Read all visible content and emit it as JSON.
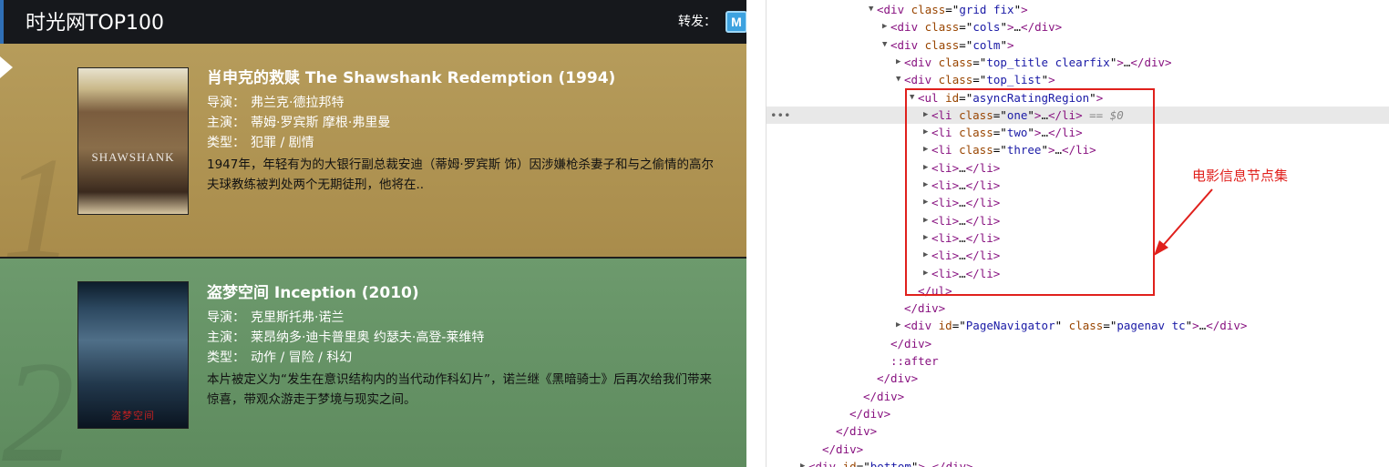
{
  "left_panel": {
    "header_title": "时光网TOP100",
    "share_label": "转发：",
    "share_icon_letter": "M",
    "movies": [
      {
        "rank": "1",
        "title": "肖申克的救赎 The Shawshank Redemption (1994)",
        "director_label": "导演：",
        "director": "弗兰克·德拉邦特",
        "cast_label": "主演：",
        "cast": "蒂姆·罗宾斯  摩根·弗里曼",
        "genre_label": "类型：",
        "genre": "犯罪 / 剧情",
        "description": "1947年，年轻有为的大银行副总裁安迪（蒂姆·罗宾斯 饰）因涉嫌枪杀妻子和与之偷情的高尔夫球教练被判处两个无期徒刑，他将在..",
        "poster_text": "SHAWSHANK"
      },
      {
        "rank": "2",
        "title": "盗梦空间 Inception (2010)",
        "director_label": "导演：",
        "director": "克里斯托弗·诺兰",
        "cast_label": "主演：",
        "cast": "莱昂纳多·迪卡普里奥  约瑟夫·高登-莱维特",
        "genre_label": "类型：",
        "genre": "动作 / 冒险 / 科幻",
        "description": "本片被定义为“发生在意识结构内的当代动作科幻片”，诺兰继《黑暗骑士》后再次给我们带来惊喜，带观众游走于梦境与现实之间。",
        "poster_text": "盗梦空间"
      }
    ]
  },
  "devtools": {
    "lines": [
      {
        "indent": 112,
        "tri": "▼",
        "html": "<span class='tag'>&lt;div</span> <span class='attr'>class</span>=\"<span class='val'>grid fix</span>\"<span class='tag'>&gt;</span>"
      },
      {
        "indent": 127,
        "tri": "▶",
        "html": "<span class='tag'>&lt;div</span> <span class='attr'>class</span>=\"<span class='val'>cols</span>\"<span class='tag'>&gt;</span><span class='txt'>…</span><span class='tag'>&lt;/div&gt;</span>"
      },
      {
        "indent": 127,
        "tri": "▼",
        "html": "<span class='tag'>&lt;div</span> <span class='attr'>class</span>=\"<span class='val'>colm</span>\"<span class='tag'>&gt;</span>"
      },
      {
        "indent": 142,
        "tri": "▶",
        "html": "<span class='tag'>&lt;div</span> <span class='attr'>class</span>=\"<span class='val'>top_title clearfix</span>\"<span class='tag'>&gt;</span><span class='txt'>…</span><span class='tag'>&lt;/div&gt;</span>"
      },
      {
        "indent": 142,
        "tri": "▼",
        "html": "<span class='tag'>&lt;div</span> <span class='attr'>class</span>=\"<span class='val'>top_list</span>\"<span class='tag'>&gt;</span>"
      },
      {
        "indent": 157,
        "tri": "▼",
        "html": "<span class='tag'>&lt;ul</span> <span class='attr'>id</span>=\"<span class='val'>asyncRatingRegion</span>\"<span class='tag'>&gt;</span>"
      },
      {
        "indent": 172,
        "tri": "▶",
        "highlight": true,
        "html": "<span class='tag'>&lt;li</span> <span class='attr'>class</span>=\"<span class='val'>one</span>\"<span class='tag'>&gt;</span><span class='txt'>…</span><span class='tag'>&lt;/li&gt;</span> <span class='cmt'>== $0</span>"
      },
      {
        "indent": 172,
        "tri": "▶",
        "html": "<span class='tag'>&lt;li</span> <span class='attr'>class</span>=\"<span class='val'>two</span>\"<span class='tag'>&gt;</span><span class='txt'>…</span><span class='tag'>&lt;/li&gt;</span>"
      },
      {
        "indent": 172,
        "tri": "▶",
        "html": "<span class='tag'>&lt;li</span> <span class='attr'>class</span>=\"<span class='val'>three</span>\"<span class='tag'>&gt;</span><span class='txt'>…</span><span class='tag'>&lt;/li&gt;</span>"
      },
      {
        "indent": 172,
        "tri": "▶",
        "html": "<span class='tag'>&lt;li&gt;</span><span class='txt'>…</span><span class='tag'>&lt;/li&gt;</span>"
      },
      {
        "indent": 172,
        "tri": "▶",
        "html": "<span class='tag'>&lt;li&gt;</span><span class='txt'>…</span><span class='tag'>&lt;/li&gt;</span>"
      },
      {
        "indent": 172,
        "tri": "▶",
        "html": "<span class='tag'>&lt;li&gt;</span><span class='txt'>…</span><span class='tag'>&lt;/li&gt;</span>"
      },
      {
        "indent": 172,
        "tri": "▶",
        "html": "<span class='tag'>&lt;li&gt;</span><span class='txt'>…</span><span class='tag'>&lt;/li&gt;</span>"
      },
      {
        "indent": 172,
        "tri": "▶",
        "html": "<span class='tag'>&lt;li&gt;</span><span class='txt'>…</span><span class='tag'>&lt;/li&gt;</span>"
      },
      {
        "indent": 172,
        "tri": "▶",
        "html": "<span class='tag'>&lt;li&gt;</span><span class='txt'>…</span><span class='tag'>&lt;/li&gt;</span>"
      },
      {
        "indent": 172,
        "tri": "▶",
        "html": "<span class='tag'>&lt;li&gt;</span><span class='txt'>…</span><span class='tag'>&lt;/li&gt;</span>"
      },
      {
        "indent": 157,
        "tri": "",
        "html": "<span class='tag'>&lt;/ul&gt;</span>"
      },
      {
        "indent": 142,
        "tri": "",
        "html": "<span class='tag'>&lt;/div&gt;</span>"
      },
      {
        "indent": 142,
        "tri": "▶",
        "html": "<span class='tag'>&lt;div</span> <span class='attr'>id</span>=\"<span class='val'>PageNavigator</span>\" <span class='attr'>class</span>=\"<span class='val'>pagenav tc</span>\"<span class='tag'>&gt;</span><span class='txt'>…</span><span class='tag'>&lt;/div&gt;</span>"
      },
      {
        "indent": 127,
        "tri": "",
        "html": "<span class='tag'>&lt;/div&gt;</span>"
      },
      {
        "indent": 127,
        "tri": "",
        "html": "<span class='pseudo'>::after</span>"
      },
      {
        "indent": 112,
        "tri": "",
        "html": "<span class='tag'>&lt;/div&gt;</span>"
      },
      {
        "indent": 97,
        "tri": "",
        "html": "<span class='tag'>&lt;/div&gt;</span>"
      },
      {
        "indent": 82,
        "tri": "",
        "html": "<span class='tag'>&lt;/div&gt;</span>"
      },
      {
        "indent": 67,
        "tri": "",
        "html": "<span class='tag'>&lt;/div&gt;</span>"
      },
      {
        "indent": 52,
        "tri": "",
        "html": "<span class='tag'>&lt;/div&gt;</span>"
      },
      {
        "indent": 37,
        "tri": "▶",
        "html": "<span class='tag'>&lt;div</span> <span class='attr'>id</span>=\"<span class='val'>bottom</span>\"<span class='tag'>&gt;</span><span class='txt'>…</span><span class='tag'>&lt;/div&gt;</span>"
      }
    ],
    "annotation": "电影信息节点集",
    "annotation_color": "#e0201c"
  }
}
